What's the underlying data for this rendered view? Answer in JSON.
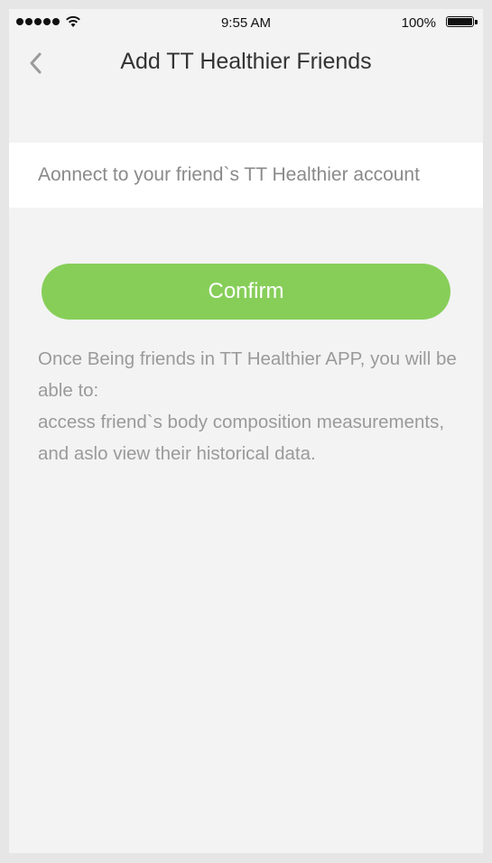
{
  "status_bar": {
    "time": "9:55 AM",
    "battery": "100%",
    "battery_level": 1.0,
    "signal_dots": 5
  },
  "nav": {
    "title": "Add TT Healthier Friends",
    "back_icon": "chevron-left-icon"
  },
  "search": {
    "placeholder": "Aonnect to your friend`s TT Healthier account",
    "value": ""
  },
  "confirm_label": "Confirm",
  "description": {
    "line1": "Once Being friends in TT Healthier APP, you will be able to:",
    "line2": "access friend`s body composition measurements, and aslo view their historical data."
  },
  "colors": {
    "accent": "#87ce59",
    "background": "#f3f3f3",
    "text_muted": "#9a9a9a"
  }
}
